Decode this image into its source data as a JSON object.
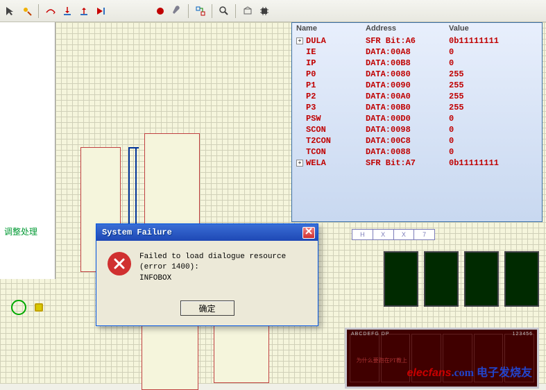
{
  "side_panel": {
    "label": "调整处理"
  },
  "watch": {
    "headers": {
      "name": "Name",
      "address": "Address",
      "value": "Value"
    },
    "rows": [
      {
        "name": "DULA",
        "address": "SFR Bit:A6",
        "value": "0b11111111",
        "expandable": true
      },
      {
        "name": "IE",
        "address": "DATA:00A8",
        "value": "0",
        "expandable": false
      },
      {
        "name": "IP",
        "address": "DATA:00B8",
        "value": "0",
        "expandable": false
      },
      {
        "name": "P0",
        "address": "DATA:0080",
        "value": "255",
        "expandable": false
      },
      {
        "name": "P1",
        "address": "DATA:0090",
        "value": "255",
        "expandable": false
      },
      {
        "name": "P2",
        "address": "DATA:00A0",
        "value": "255",
        "expandable": false
      },
      {
        "name": "P3",
        "address": "DATA:00B0",
        "value": "255",
        "expandable": false
      },
      {
        "name": "PSW",
        "address": "DATA:00D0",
        "value": "0",
        "expandable": false
      },
      {
        "name": "SCON",
        "address": "DATA:0098",
        "value": "0",
        "expandable": false
      },
      {
        "name": "T2CON",
        "address": "DATA:00C8",
        "value": "0",
        "expandable": false
      },
      {
        "name": "TCON",
        "address": "DATA:0088",
        "value": "0",
        "expandable": false
      },
      {
        "name": "WELA",
        "address": "SFR Bit:A7",
        "value": "0b11111111",
        "expandable": true
      }
    ]
  },
  "mini_grid": {
    "cells": [
      "H",
      "X",
      "X",
      "7"
    ]
  },
  "dialog": {
    "title": "System Failure",
    "message_line1": "Failed to load dialogue resource (error 1400):",
    "message_line2": "INFOBOX",
    "ok_label": "确定"
  },
  "seg_big": {
    "left_label": "ABCDEFG DP",
    "right_label": "123456"
  },
  "watermark": {
    "red": "elecfans",
    "blue_suffix": ".com 电子发烧友"
  },
  "tiny_text": "为什么要跑在PT教上"
}
